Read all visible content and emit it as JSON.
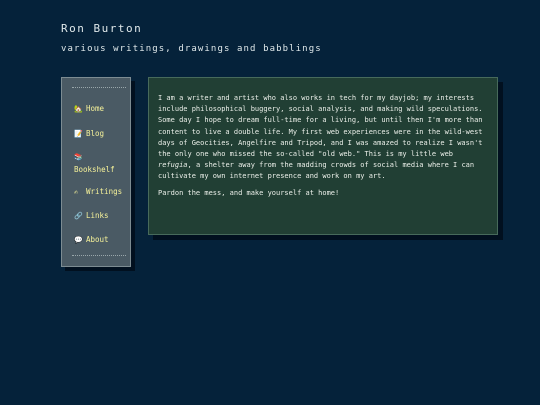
{
  "site": {
    "title": "Ron Burton",
    "tagline": "various writings, drawings and babblings"
  },
  "nav": [
    {
      "label": "Home",
      "icon": "🏡",
      "icon_name": "house-icon"
    },
    {
      "label": "Blog",
      "icon": "📝",
      "icon_name": "memo-icon"
    },
    {
      "label": "Bookshelf",
      "icon": "📚",
      "icon_name": "books-icon"
    },
    {
      "label": "Writings",
      "icon": "✍",
      "icon_name": "writing-hand-icon"
    },
    {
      "label": "Links",
      "icon": "🔗",
      "icon_name": "link-icon"
    },
    {
      "label": "About",
      "icon": "💬",
      "icon_name": "speech-bubble-icon"
    }
  ],
  "content": {
    "intro_before_em": "I am a writer and artist who also works in tech for my dayjob; my interests include philosophical buggery, social analysis, and making wild speculations. Some day I hope to dream full-time for a living, but until then I'm more than content to live a double life. My first web experiences were in the wild-west days of Geocities, Angelfire and Tripod, and I was amazed to realize I wasn't the only one who missed the so-called \"old web.\" This is my little web ",
    "intro_em": "refugia",
    "intro_after_em": ", a shelter away from the madding crowds of social media where I can cultivate my own internet presence and work on my art.",
    "closing": "Pardon the mess, and make yourself at home!"
  },
  "colors": {
    "background": "#05223a",
    "sidebar": "#4a5a64",
    "panel": "#213f34",
    "nav_link": "#f7f39a",
    "text": "#ecf0ea"
  }
}
